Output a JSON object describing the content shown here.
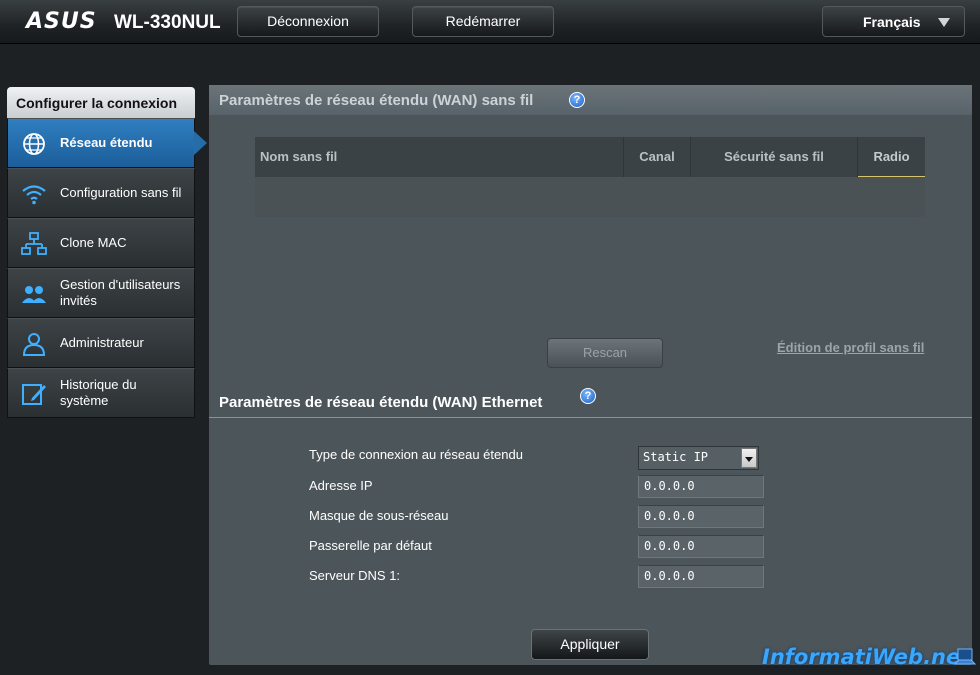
{
  "header": {
    "logo": "ASUS",
    "model": "WL-330NUL",
    "logout_label": "Déconnexion",
    "reboot_label": "Redémarrer",
    "language": "Français"
  },
  "sidebar": {
    "title": "Configurer la connexion",
    "items": [
      {
        "label": "Réseau étendu",
        "icon": "globe-icon",
        "active": true
      },
      {
        "label": "Configuration sans fil",
        "icon": "wifi-icon",
        "active": false
      },
      {
        "label": "Clone MAC",
        "icon": "network-icon",
        "active": false
      },
      {
        "label": "Gestion d'utilisateurs invités",
        "icon": "guests-icon",
        "active": false
      },
      {
        "label": "Administrateur",
        "icon": "admin-icon",
        "active": false
      },
      {
        "label": "Historique du système",
        "icon": "log-icon",
        "active": false
      }
    ]
  },
  "wireless_wan": {
    "title": "Paramètres de réseau étendu (WAN) sans fil",
    "columns": [
      "Nom sans fil",
      "Canal",
      "Sécurité sans fil",
      "Radio"
    ],
    "rescan_label": "Rescan",
    "profile_link": "Édition de profil sans fil"
  },
  "ethernet_wan": {
    "title": "Paramètres de réseau étendu (WAN) Ethernet",
    "fields": [
      {
        "label": "Type de connexion au réseau étendu",
        "value": "Static IP"
      },
      {
        "label": "Adresse IP",
        "value": "0.0.0.0"
      },
      {
        "label": "Masque de sous-réseau",
        "value": "0.0.0.0"
      },
      {
        "label": "Passerelle par défaut",
        "value": "0.0.0.0"
      },
      {
        "label": "Serveur DNS 1:",
        "value": "0.0.0.0"
      }
    ],
    "apply_label": "Appliquer"
  },
  "watermark": "InformatiWeb.net",
  "colors": {
    "accent": "#2473b5",
    "panel": "#4c5559",
    "background": "#1d2124"
  }
}
